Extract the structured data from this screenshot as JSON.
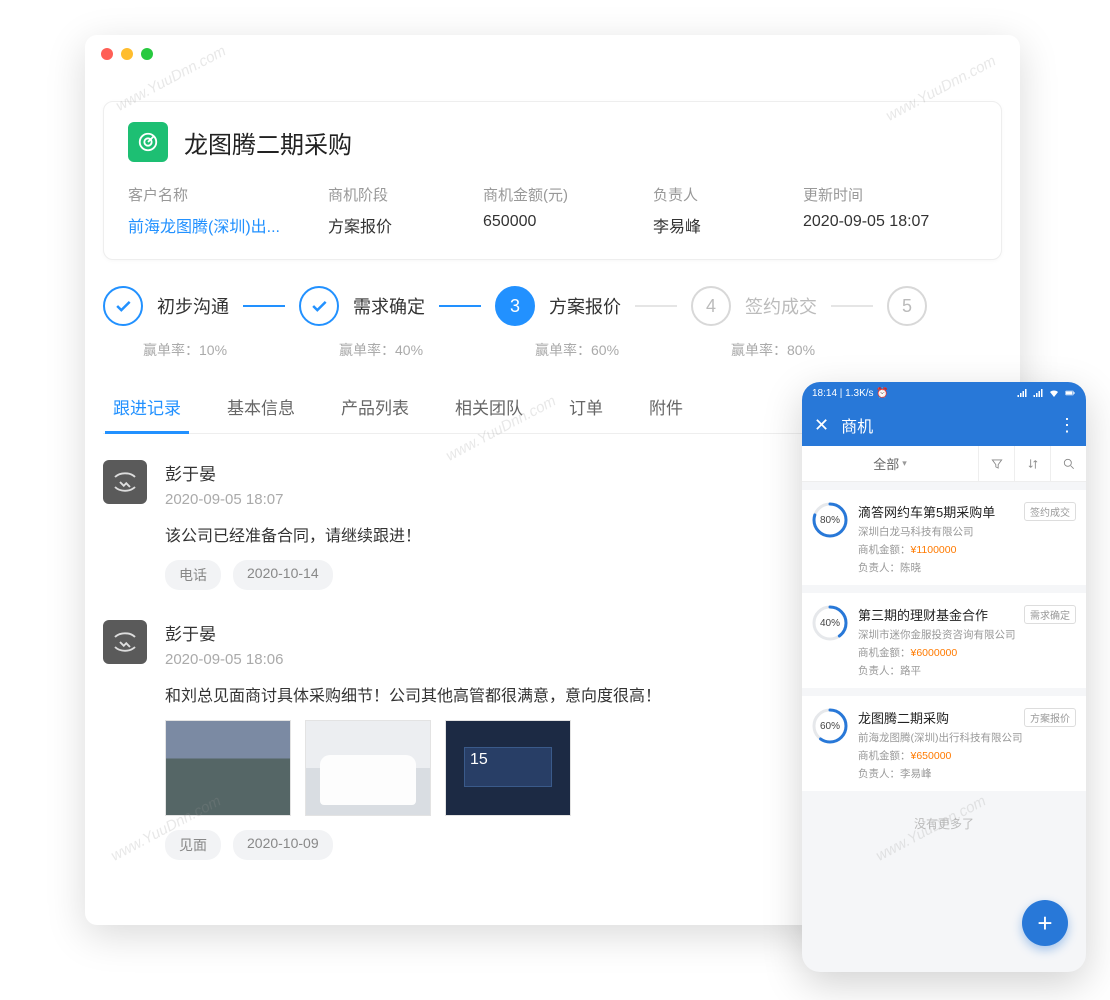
{
  "header": {
    "title": "龙图腾二期采购",
    "meta": [
      {
        "label": "客户名称",
        "value": "前海龙图腾(深圳)出...",
        "link": true
      },
      {
        "label": "商机阶段",
        "value": "方案报价"
      },
      {
        "label": "商机金额(元)",
        "value": "650000"
      },
      {
        "label": "负责人",
        "value": "李易峰"
      },
      {
        "label": "更新时间",
        "value": "2020-09-05 18:07"
      }
    ]
  },
  "stages": [
    {
      "name": "初步沟通",
      "winrate_label": "赢单率：",
      "winrate": "10%",
      "state": "done"
    },
    {
      "name": "需求确定",
      "winrate_label": "赢单率：",
      "winrate": "40%",
      "state": "done"
    },
    {
      "name": "方案报价",
      "winrate_label": "赢单率：",
      "winrate": "60%",
      "state": "current",
      "num": "3"
    },
    {
      "name": "签约成交",
      "winrate_label": "赢单率：",
      "winrate": "80%",
      "state": "pending",
      "num": "4"
    },
    {
      "name": "",
      "winrate_label": "",
      "winrate": "",
      "state": "pending",
      "num": "5"
    }
  ],
  "tabs": [
    "跟进记录",
    "基本信息",
    "产品列表",
    "相关团队",
    "订单",
    "附件"
  ],
  "active_tab": 0,
  "feed": [
    {
      "name": "彭于晏",
      "time": "2020-09-05 18:07",
      "text": "该公司已经准备合同，请继续跟进！",
      "chips": [
        "电话",
        "2020-10-14"
      ]
    },
    {
      "name": "彭于晏",
      "time": "2020-09-05 18:06",
      "text": "和刘总见面商讨具体采购细节！公司其他高管都很满意，意向度很高！",
      "thumbs": 3,
      "thumb3_num": "15",
      "chips": [
        "见面",
        "2020-10-09"
      ]
    }
  ],
  "phone": {
    "status_time": "18:14 | 1.3K/s",
    "header_title": "商机",
    "filter_all": "全部",
    "items": [
      {
        "pct": "80%",
        "pct_val": 80,
        "title": "滴答网约车第5期采购单",
        "company": "深圳白龙马科技有限公司",
        "amount_label": "商机金额：",
        "amount": "¥1100000",
        "owner_label": "负责人：",
        "owner": "陈晓",
        "badge": "签约成交"
      },
      {
        "pct": "40%",
        "pct_val": 40,
        "title": "第三期的理财基金合作",
        "company": "深圳市迷你金服投资咨询有限公司",
        "amount_label": "商机金额：",
        "amount": "¥6000000",
        "owner_label": "负责人：",
        "owner": "路平",
        "badge": "需求确定"
      },
      {
        "pct": "60%",
        "pct_val": 60,
        "title": "龙图腾二期采购",
        "company": "前海龙图腾(深圳)出行科技有限公司",
        "amount_label": "商机金额：",
        "amount": "¥650000",
        "owner_label": "负责人：",
        "owner": "李易峰",
        "badge": "方案报价"
      }
    ],
    "footer": "没有更多了"
  },
  "watermark": "www.YuuDnn.com"
}
